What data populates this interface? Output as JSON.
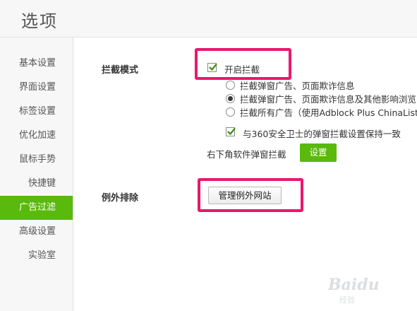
{
  "header": {
    "title": "选项"
  },
  "sidebar": {
    "items": [
      {
        "label": "基本设置",
        "active": false
      },
      {
        "label": "界面设置",
        "active": false
      },
      {
        "label": "标签设置",
        "active": false
      },
      {
        "label": "优化加速",
        "active": false
      },
      {
        "label": "鼠标手势",
        "active": false
      },
      {
        "label": "快捷键",
        "active": false
      },
      {
        "label": "广告过滤",
        "active": true
      },
      {
        "label": "高级设置",
        "active": false
      },
      {
        "label": "实验室",
        "active": false
      }
    ]
  },
  "block_mode": {
    "label": "拦截模式",
    "enable_checkbox": {
      "label": "开启拦截",
      "checked": true
    },
    "options": [
      {
        "label": "拦截弹窗广告、页面欺诈信息",
        "selected": false
      },
      {
        "label": "拦截弹窗广告、页面欺诈信息及其他影响浏览",
        "selected": true
      },
      {
        "label": "拦截所有广告（使用Adblock Plus ChinaList",
        "selected": false
      }
    ],
    "sync_checkbox": {
      "label": "与360安全卫士的弹窗拦截设置保持一致",
      "checked": true
    },
    "popup_label": "右下角软件弹窗拦截",
    "settings_button": "设置"
  },
  "exceptions": {
    "label": "例外排除",
    "manage_button": "管理例外网站"
  },
  "watermark": {
    "brand": "Baidu",
    "sub": "经验"
  },
  "colors": {
    "accent": "#59b90c",
    "highlight": "#e8186d"
  }
}
